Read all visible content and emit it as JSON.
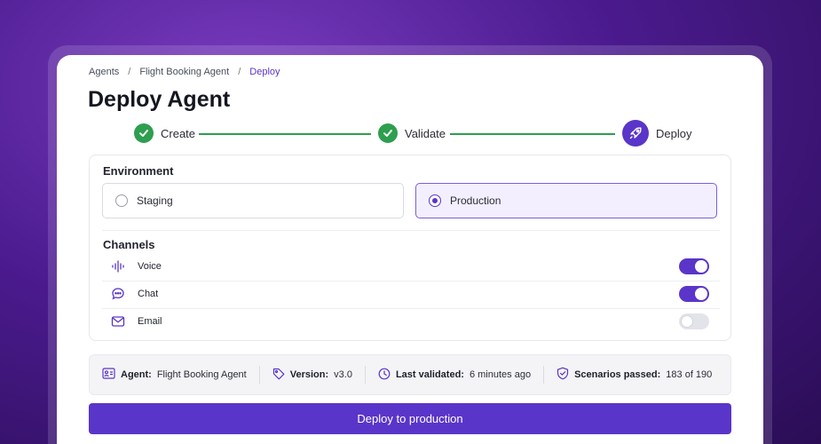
{
  "breadcrumb": {
    "items": [
      "Agents",
      "Flight Booking Agent",
      "Deploy"
    ],
    "separator": "/"
  },
  "page": {
    "title": "Deploy Agent"
  },
  "stepper": {
    "steps": [
      {
        "label": "Create",
        "state": "done",
        "icon": "check-icon"
      },
      {
        "label": "Validate",
        "state": "done",
        "icon": "check-icon"
      },
      {
        "label": "Deploy",
        "state": "active",
        "icon": "rocket-icon"
      }
    ]
  },
  "environment": {
    "label": "Environment",
    "options": [
      {
        "label": "Staging",
        "selected": false
      },
      {
        "label": "Production",
        "selected": true
      }
    ]
  },
  "channels": {
    "label": "Channels",
    "items": [
      {
        "label": "Voice",
        "icon": "voice-wave-icon",
        "enabled": true
      },
      {
        "label": "Chat",
        "icon": "chat-bubble-icon",
        "enabled": true
      },
      {
        "label": "Email",
        "icon": "mail-icon",
        "enabled": false
      }
    ]
  },
  "summary": {
    "agent": {
      "key": "Agent:",
      "value": "Flight Booking Agent",
      "icon": "id-card-icon"
    },
    "version": {
      "key": "Version:",
      "value": "v3.0",
      "icon": "tag-icon"
    },
    "validated": {
      "key": "Last validated:",
      "value": "6 minutes ago",
      "icon": "clock-icon"
    },
    "scenarios": {
      "key": "Scenarios passed:",
      "value": "183 of 190",
      "icon": "shield-check-icon"
    }
  },
  "actions": {
    "deploy_label": "Deploy to production"
  },
  "colors": {
    "accent": "#5a35c9",
    "success": "#2e9e4f",
    "selected_bg": "#f3efff"
  }
}
